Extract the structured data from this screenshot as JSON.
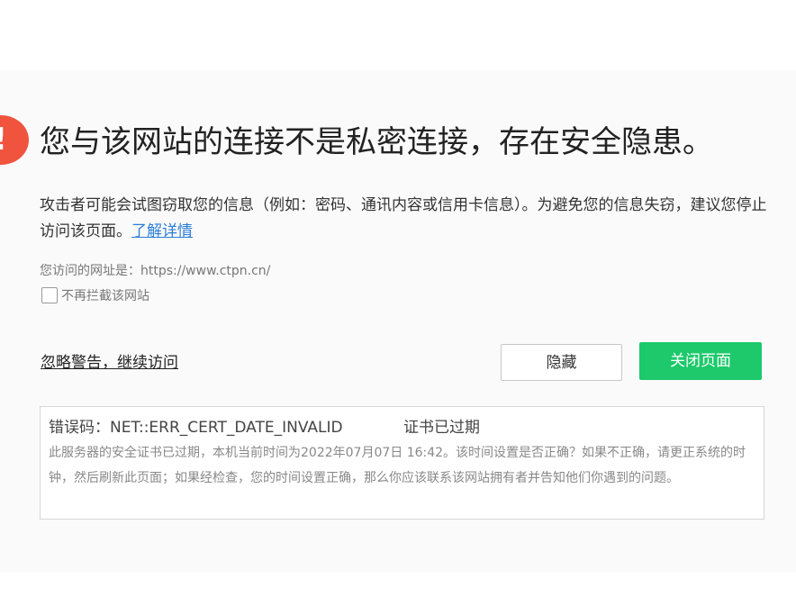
{
  "warning": {
    "icon": "exclamation-icon",
    "icon_glyph": "!",
    "title": "您与该网站的连接不是私密连接，存在安全隐患。",
    "description": "攻击者可能会试图窃取您的信息（例如：密码、通讯内容或信用卡信息）。为避免您的信息失窃，建议您停止访问该页面。",
    "learn_more": "了解详情",
    "url_label": "您访问的网址是：https://www.ctpn.cn/",
    "no_block_label": "不再拦截该网站"
  },
  "actions": {
    "ignore_label": "忽略警告，继续访问",
    "hide_label": "隐藏",
    "close_label": "关闭页面"
  },
  "error": {
    "code": "错误码：NET::ERR_CERT_DATE_INVALID",
    "status": "证书已过期",
    "detail": "此服务器的安全证书已过期，本机当前时间为2022年07月07日 16:42。该时间设置是否正确？如果不正确，请更正系统的时钟，然后刷新此页面；如果经检查，您的时间设置正确，那么你应该联系该网站拥有者并告知他们你遇到的问题。"
  },
  "colors": {
    "accent_green": "#1dc96b",
    "warning_red": "#f0533e",
    "link_blue": "#2d7fd8"
  }
}
